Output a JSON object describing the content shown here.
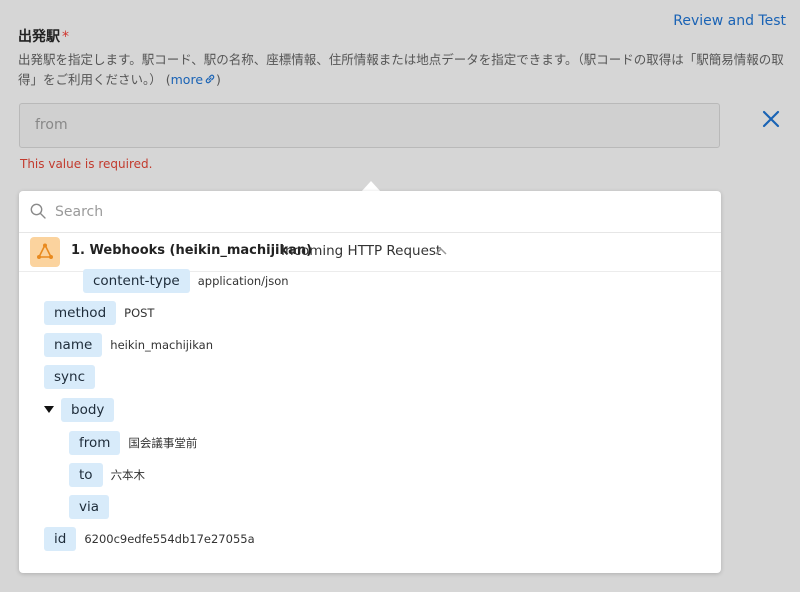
{
  "header": {
    "review_label": "Review and Test"
  },
  "field": {
    "label": "出発駅",
    "required_mark": "*",
    "description": "出発駅を指定します。駅コード、駅の名称、座標情報、住所情報または地点データを指定できます。（駅コードの取得は「駅簡易情報の取得」をご利用ください。）",
    "more_label": "more",
    "value": "from",
    "error": "This value is required."
  },
  "dropdown": {
    "search_placeholder": "Search",
    "step_title": "1. Webhooks (heikin_machijikan)",
    "step_subtitle": "Incoming HTTP Request",
    "items": [
      {
        "key": "content-type",
        "value": "application/json"
      },
      {
        "key": "method",
        "value": "POST"
      },
      {
        "key": "name",
        "value": "heikin_machijikan"
      },
      {
        "key": "sync",
        "value": ""
      },
      {
        "key": "body",
        "value": ""
      },
      {
        "key": "from",
        "value": "国会議事堂前"
      },
      {
        "key": "to",
        "value": "六本木"
      },
      {
        "key": "via",
        "value": ""
      },
      {
        "key": "id",
        "value": "6200c9edfe554db17e27055a"
      }
    ]
  },
  "colors": {
    "accent": "#1a63b5",
    "error": "#c23a2d",
    "chip_bg": "#d8ebfa",
    "step_icon_bg": "#fbd39e"
  }
}
